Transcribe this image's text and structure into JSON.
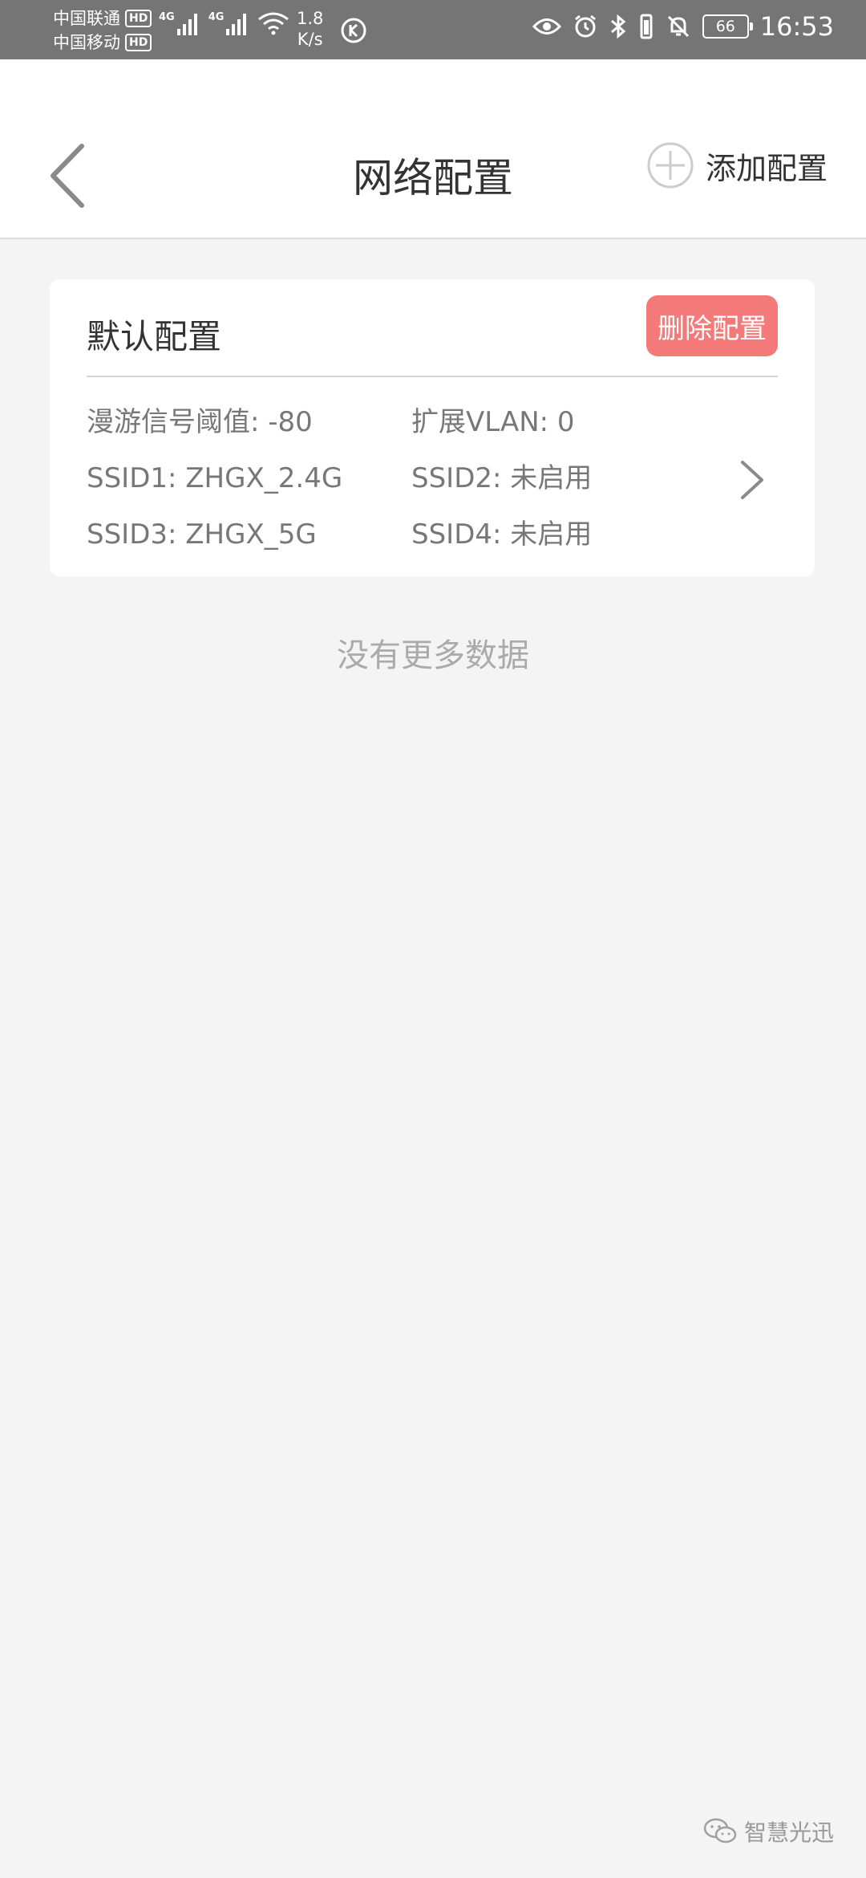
{
  "status_bar": {
    "carrier1": "中国联通",
    "carrier2": "中国移动",
    "hd_badge": "HD",
    "net_type1": "4G",
    "net_type2": "4G",
    "speed_value": "1.8",
    "speed_unit": "K/s",
    "battery": "66",
    "time": "16:53",
    "icons": [
      "eye-icon",
      "alarm-icon",
      "bluetooth-icon",
      "vibrate-icon",
      "bell-off-icon",
      "battery-icon"
    ]
  },
  "header": {
    "title": "网络配置",
    "add_label": "添加配置"
  },
  "config_card": {
    "title": "默认配置",
    "delete_label": "删除配置",
    "rows": [
      [
        "漫游信号阈值: -80",
        "扩展VLAN: 0"
      ],
      [
        "SSID1: ZHGX_2.4G",
        "SSID2: 未启用"
      ],
      [
        "SSID3: ZHGX_5G",
        "SSID4: 未启用"
      ]
    ]
  },
  "list_footer": "没有更多数据",
  "watermark": "智慧光迅",
  "colors": {
    "status_bar": "#757575",
    "delete_button": "#f47a7a",
    "background": "#f4f4f4"
  }
}
